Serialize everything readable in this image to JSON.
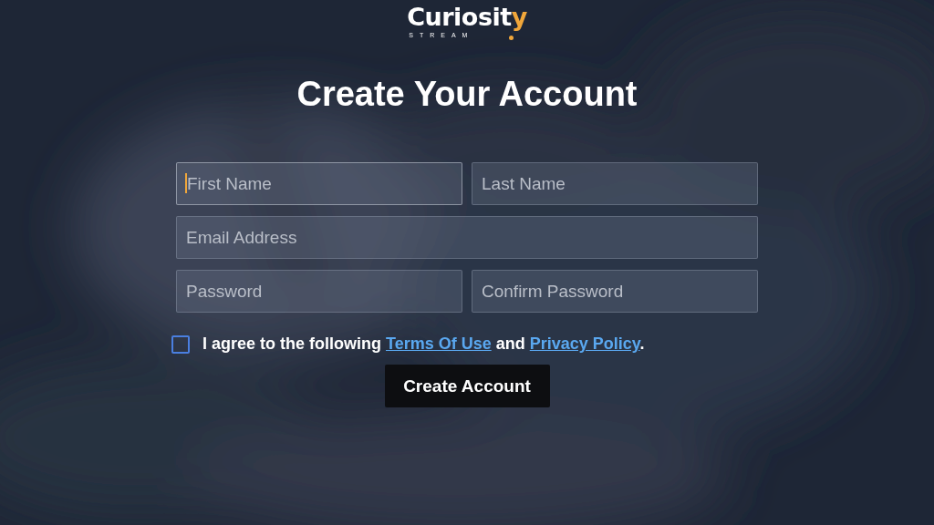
{
  "logo": {
    "main": "Curiosit",
    "accent": "y",
    "tagline": "STREAM"
  },
  "title": "Create Your Account",
  "fields": [
    {
      "placeholder": "First Name",
      "focused": true,
      "kind": "half"
    },
    {
      "placeholder": "Last Name",
      "focused": false,
      "kind": "half"
    },
    {
      "placeholder": "Email Address",
      "focused": false,
      "kind": "full"
    },
    {
      "placeholder": "Password",
      "focused": false,
      "kind": "half"
    },
    {
      "placeholder": "Confirm Password",
      "focused": false,
      "kind": "half"
    }
  ],
  "agreement": {
    "checked": false,
    "parts": [
      {
        "kind": "text",
        "text": "I agree to the following "
      },
      {
        "kind": "link",
        "text": "Terms Of Use"
      },
      {
        "kind": "text",
        "text": " and "
      },
      {
        "kind": "link",
        "text": "Privacy Policy"
      },
      {
        "kind": "text",
        "text": "."
      }
    ]
  },
  "submit": "Create Account"
}
